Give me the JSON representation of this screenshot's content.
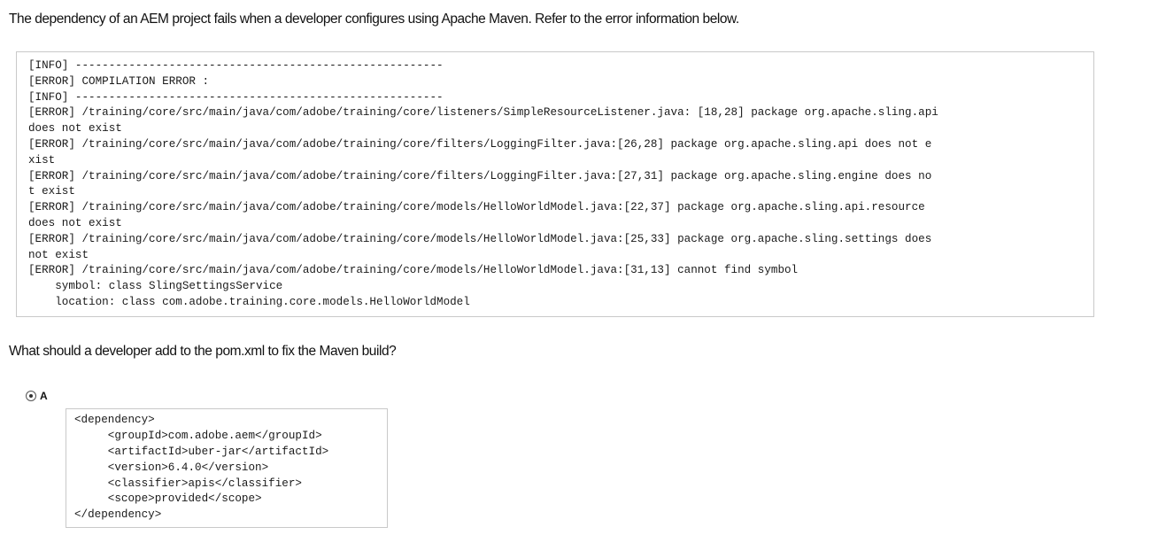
{
  "question": {
    "text": "The dependency of an AEM project fails when a developer configures using Apache Maven. Refer to the error information below."
  },
  "error_log": {
    "lines": [
      "[INFO] -------------------------------------------------------",
      "[ERROR] COMPILATION ERROR :",
      "[INFO] -------------------------------------------------------",
      "[ERROR] /training/core/src/main/java/com/adobe/training/core/listeners/SimpleResourceListener.java: [18,28] package org.apache.sling.api",
      "does not exist",
      "[ERROR] /training/core/src/main/java/com/adobe/training/core/filters/LoggingFilter.java:[26,28] package org.apache.sling.api does not e",
      "xist",
      "[ERROR] /training/core/src/main/java/com/adobe/training/core/filters/LoggingFilter.java:[27,31] package org.apache.sling.engine does no",
      "t exist",
      "[ERROR] /training/core/src/main/java/com/adobe/training/core/models/HelloWorldModel.java:[22,37] package org.apache.sling.api.resource",
      "does not exist",
      "[ERROR] /training/core/src/main/java/com/adobe/training/core/models/HelloWorldModel.java:[25,33] package org.apache.sling.settings does",
      "not exist",
      "[ERROR] /training/core/src/main/java/com/adobe/training/core/models/HelloWorldModel.java:[31,13] cannot find symbol",
      "    symbol: class SlingSettingsService",
      "    location: class com.adobe.training.core.models.HelloWorldModel"
    ]
  },
  "followup": {
    "text": "What should a developer add to the pom.xml to fix the Maven build?"
  },
  "options": [
    {
      "letter": "A",
      "selected": true,
      "code_lines": [
        "<dependency>",
        "     <groupId>com.adobe.aem</groupId>",
        "     <artifactId>uber-jar</artifactId>",
        "     <version>6.4.0</version>",
        "     <classifier>apis</classifier>",
        "     <scope>provided</scope>",
        "</dependency>"
      ]
    }
  ]
}
